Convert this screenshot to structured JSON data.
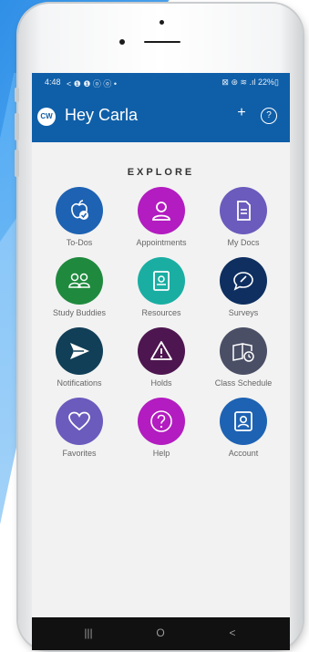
{
  "status_bar": {
    "time": "4:48",
    "left_icons": "< ❶ ❶ ⓞ ⓞ •",
    "right_icons": "⊠ ⊛ ≋ .ıl 22%▯"
  },
  "header": {
    "logo": "CW",
    "greeting": "Hey Carla",
    "add_icon": "+",
    "help_icon": "?"
  },
  "explore": {
    "title": "EXPLORE",
    "tiles": [
      {
        "label": "To-Dos",
        "color": "#1e62b3",
        "icon": "apple-check-icon"
      },
      {
        "label": "Appointments",
        "color": "#b31cc0",
        "icon": "person-icon"
      },
      {
        "label": "My Docs",
        "color": "#6a5bbd",
        "icon": "document-icon"
      },
      {
        "label": "Study Buddies",
        "color": "#1f8a3e",
        "icon": "group-icon"
      },
      {
        "label": "Resources",
        "color": "#1aaea3",
        "icon": "resources-icon"
      },
      {
        "label": "Surveys",
        "color": "#0e2f60",
        "icon": "chat-bubble-icon"
      },
      {
        "label": "Notifications",
        "color": "#113f57",
        "icon": "send-icon"
      },
      {
        "label": "Holds",
        "color": "#4e1650",
        "icon": "warning-icon"
      },
      {
        "label": "Class Schedule",
        "color": "#4a4f66",
        "icon": "schedule-icon"
      },
      {
        "label": "Favorites",
        "color": "#6a5bbd",
        "icon": "heart-icon"
      },
      {
        "label": "Help",
        "color": "#b31cc0",
        "icon": "help-icon"
      },
      {
        "label": "Account",
        "color": "#1e62b3",
        "icon": "account-icon"
      }
    ]
  },
  "nav": {
    "recents": "|||",
    "home": "O",
    "back": "<"
  }
}
